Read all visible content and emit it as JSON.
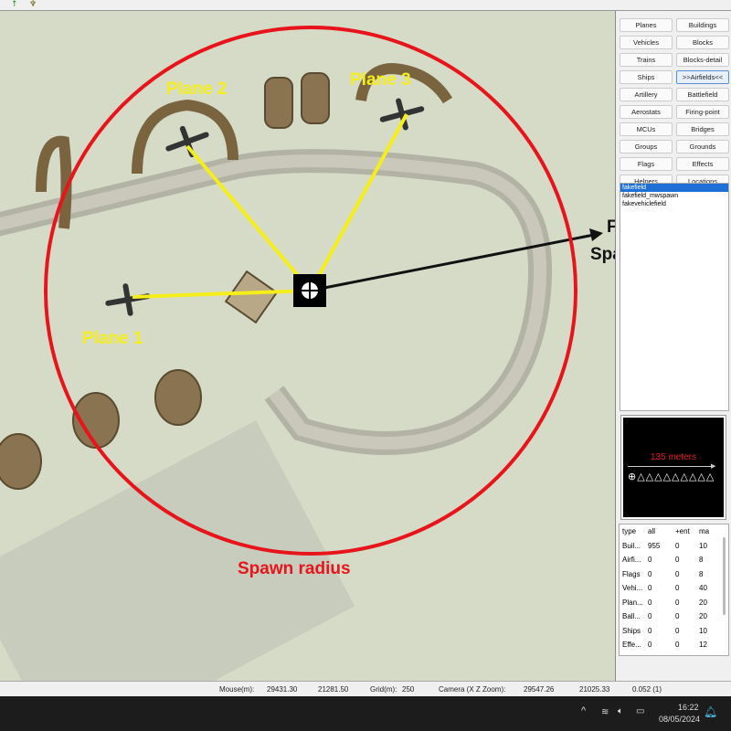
{
  "map": {
    "labels": {
      "plane1": "Plane 1",
      "plane2": "Plane 2",
      "plane3": "Plane 3",
      "spawn_point_line1": "Fakefield",
      "spawn_point_line2": "Spawn-Point",
      "spawn_radius": "Spawn radius"
    },
    "colors": {
      "radius": "#e8141c",
      "lines": "#f5ee1a",
      "arrow": "#111111"
    }
  },
  "panel": {
    "buttons": [
      "Planes",
      "Buildings",
      "Vehicles",
      "Blocks",
      "Trains",
      "Blocks-detail",
      "Ships",
      ">>Airfields<<",
      "Artillery",
      "Battlefield",
      "Aerostats",
      "Firing-point",
      "MCUs",
      "Bridges",
      "Groups",
      "Grounds",
      "Flags",
      "Effects",
      "Helpers",
      "Locations"
    ],
    "selected_button": ">>Airfields<<",
    "list": [
      "fakefield",
      "fakefield_mwspawn",
      "fakevehiclefield"
    ],
    "selected_list_item": "fakefield"
  },
  "preview": {
    "distance": "135 meters"
  },
  "stats": {
    "headers": [
      "type",
      "all",
      "+ent",
      "ma"
    ],
    "rows": [
      [
        "Buil...",
        "955",
        "0",
        "10"
      ],
      [
        "Airfi...",
        "0",
        "0",
        "8"
      ],
      [
        "Flags",
        "0",
        "0",
        "8"
      ],
      [
        "Vehi...",
        "0",
        "0",
        "40"
      ],
      [
        "Plan...",
        "0",
        "0",
        "20"
      ],
      [
        "Ball...",
        "0",
        "0",
        "20"
      ],
      [
        "Ships",
        "0",
        "0",
        "10"
      ],
      [
        "Effe...",
        "0",
        "0",
        "12"
      ]
    ]
  },
  "status": {
    "mouse_label": "Mouse(m):",
    "mouse_x": "29431.30",
    "mouse_z": "21281.50",
    "grid_label": "Grid(m):",
    "grid": "250",
    "camera_label": "Camera (X  Z  Zoom):",
    "camera_x": "29547.26",
    "camera_z": "21025.33",
    "camera_zoom": "0.052 (1)"
  },
  "taskbar": {
    "time": "16:22",
    "date": "08/05/2024"
  }
}
